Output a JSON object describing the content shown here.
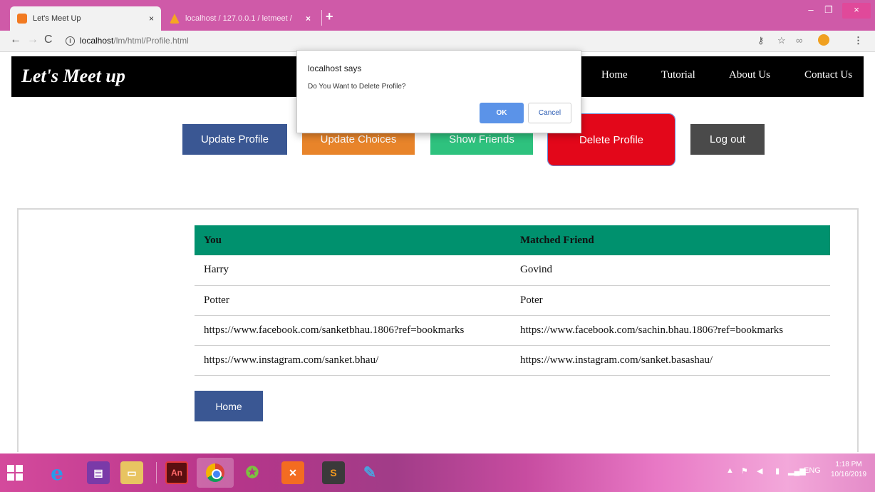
{
  "browser": {
    "tabs": [
      {
        "title": "Let's Meet Up",
        "close": "×"
      },
      {
        "title": "localhost / 127.0.0.1 / letmeet / ",
        "close": "×"
      }
    ],
    "new_tab": "+",
    "window_controls": {
      "minimize": "–",
      "maximize": "❐",
      "close": "×"
    },
    "address": {
      "host": "localhost",
      "path": "/lm/html/Profile.html"
    }
  },
  "header": {
    "brand": "Let's Meet up",
    "nav": [
      "Home",
      "Tutorial",
      "About Us",
      "Contact Us"
    ]
  },
  "actions": {
    "update_profile": "Update Profile",
    "update_choices": "Update Choices",
    "show_friends": "Show Friends",
    "delete_profile": "Delete Profile",
    "logout": "Log out"
  },
  "table": {
    "headers": [
      "You",
      "Matched Friend"
    ],
    "rows": [
      [
        "Harry",
        "Govind"
      ],
      [
        "Potter",
        "Poter"
      ],
      [
        "https://www.facebook.com/sanketbhau.1806?ref=bookmarks",
        "https://www.facebook.com/sachin.bhau.1806?ref=bookmarks"
      ],
      [
        "https://www.instagram.com/sanket.bhau/",
        "https://www.instagram.com/sanket.basashau/"
      ]
    ]
  },
  "home_button": "Home",
  "dialog": {
    "title": "localhost says",
    "message": "Do You Want to Delete Profile?",
    "ok": "OK",
    "cancel": "Cancel"
  },
  "taskbar": {
    "animate_label": "An",
    "language": "ENG",
    "time": "1:18 PM",
    "date": "10/16/2019"
  },
  "colors": {
    "update_profile": "#3a5793",
    "update_choices": "#e8842a",
    "show_friends": "#2ec27e",
    "delete_profile": "#e3071a",
    "logout": "#4a4a4a",
    "table_header": "#00916e",
    "tab_strip": "#cf5aa8"
  }
}
